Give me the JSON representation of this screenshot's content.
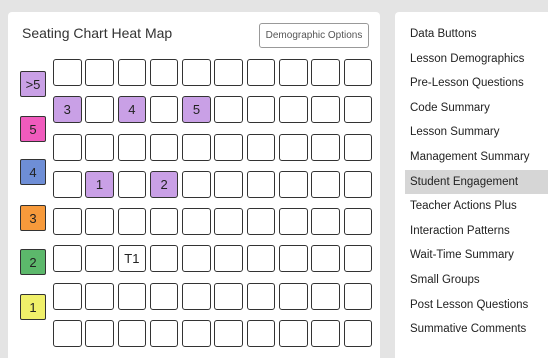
{
  "header": {
    "title": "Seating Chart Heat Map",
    "demographic_button": "Demographic Options"
  },
  "legend": [
    {
      "label": ">5",
      "color": "#c9a0e6"
    },
    {
      "label": "5",
      "color": "#f05bbd"
    },
    {
      "label": "4",
      "color": "#6e8ed6"
    },
    {
      "label": "3",
      "color": "#f79a3b"
    },
    {
      "label": "2",
      "color": "#5cb86b"
    },
    {
      "label": "1",
      "color": "#f0f06a"
    }
  ],
  "seats": {
    "rows": 8,
    "cols": 10,
    "highlight_color": "#c9a0e6",
    "cells": [
      {
        "row": 1,
        "col": 0,
        "label": "3",
        "highlight": true
      },
      {
        "row": 1,
        "col": 2,
        "label": "4",
        "highlight": true
      },
      {
        "row": 1,
        "col": 4,
        "label": "5",
        "highlight": true
      },
      {
        "row": 3,
        "col": 1,
        "label": "1",
        "highlight": true
      },
      {
        "row": 3,
        "col": 3,
        "label": "2",
        "highlight": true
      },
      {
        "row": 5,
        "col": 2,
        "label": "T1",
        "highlight": false
      }
    ]
  },
  "menu": {
    "items": [
      "Data Buttons",
      "Lesson Demographics",
      "Pre-Lesson Questions",
      "Code Summary",
      "Lesson Summary",
      "Management Summary",
      "Student Engagement",
      "Teacher Actions Plus",
      "Interaction Patterns",
      "Wait-Time Summary",
      "Small Groups",
      "Post Lesson Questions",
      "Summative Comments"
    ],
    "active": "Student Engagement"
  }
}
